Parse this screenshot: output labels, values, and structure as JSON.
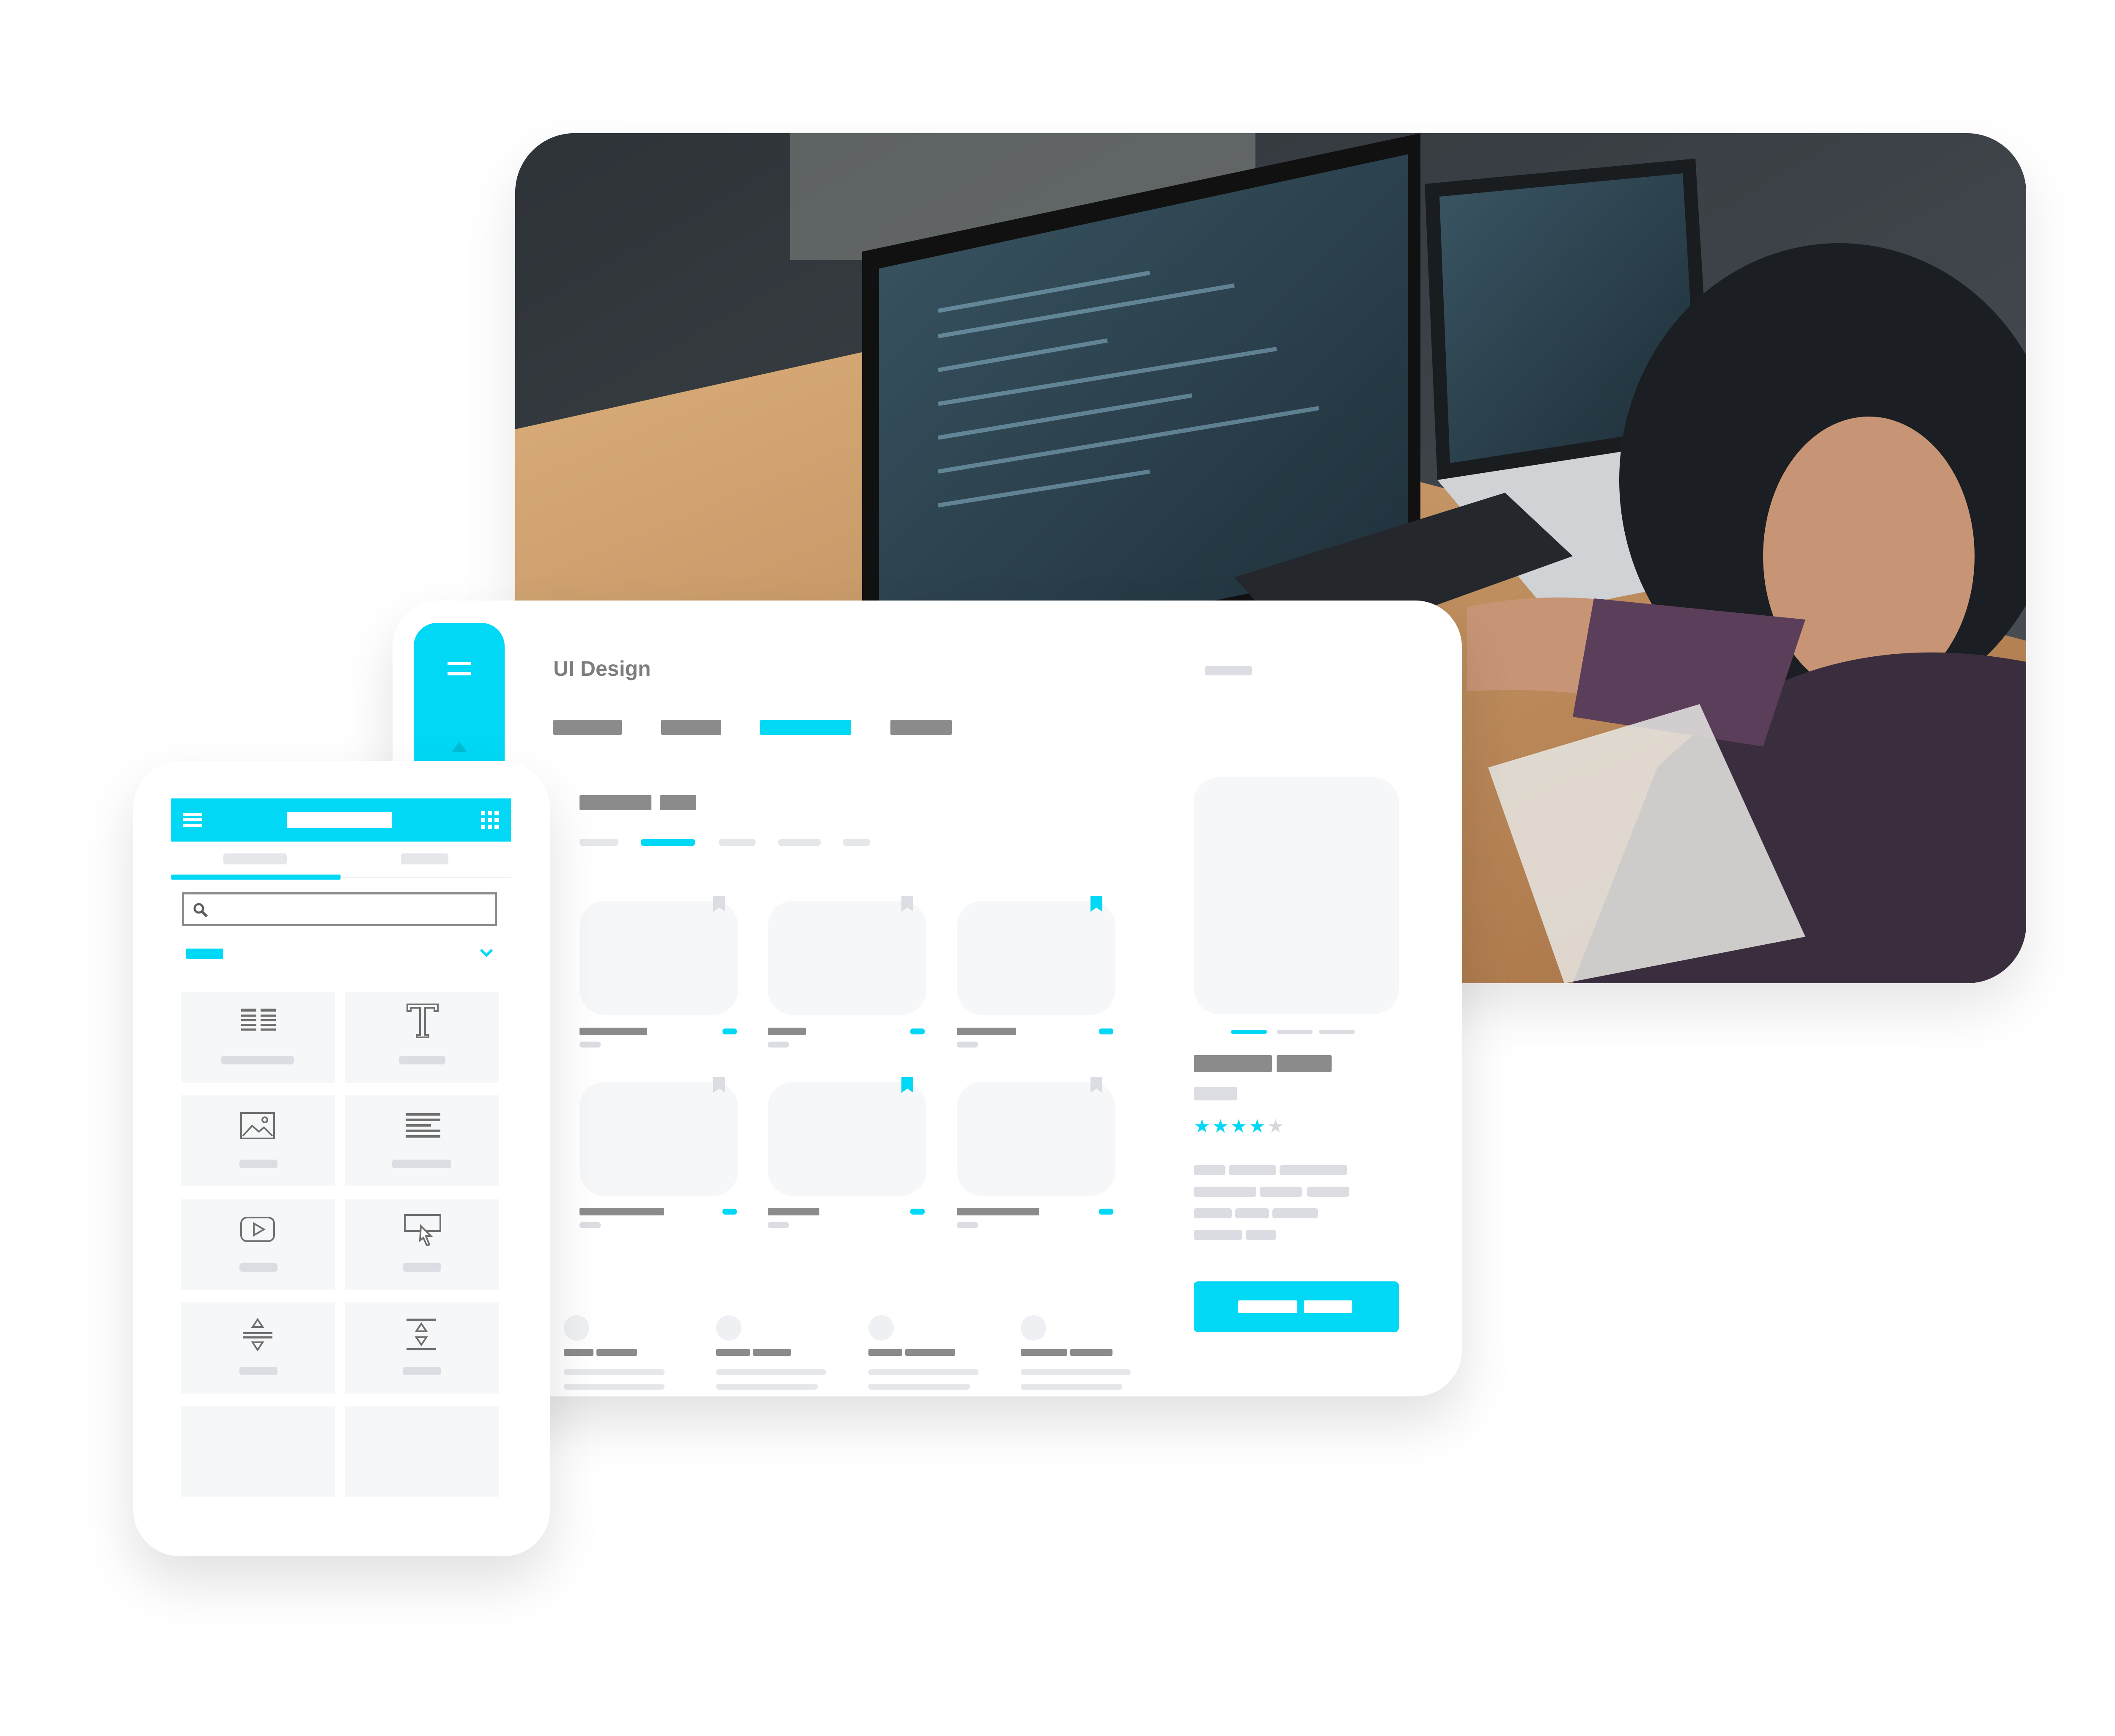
{
  "desktop": {
    "title": "UI Design"
  },
  "product": {
    "rating": 4,
    "rating_max": 5,
    "star_on": "★",
    "star_off": "★"
  },
  "icons": {
    "rail": "menu-icon",
    "mobile_header_left": "hamburger-icon",
    "mobile_header_right": "grid-icon",
    "search": "search-icon",
    "dropdown": "chevron-down-icon",
    "widgets": [
      "columns-icon",
      "text-icon",
      "image-icon",
      "paragraph-icon",
      "video-icon",
      "cursor-icon",
      "divider-icon",
      "spacer-icon"
    ]
  },
  "colors": {
    "accent": "#00d8f5",
    "placeholder_bar": "#8b8b8b",
    "tile": "#f6f7f9"
  }
}
